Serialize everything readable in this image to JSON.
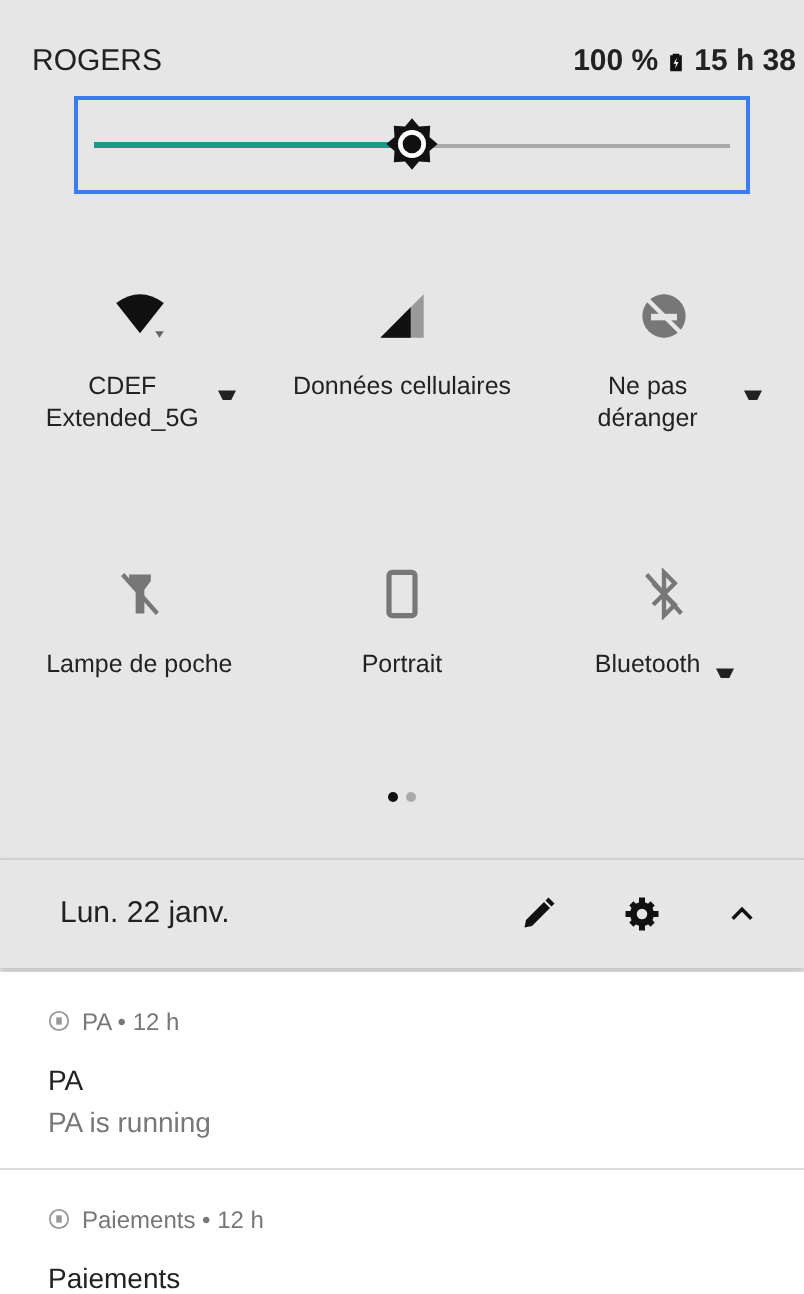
{
  "status_bar": {
    "carrier": "ROGERS",
    "battery": "100 %",
    "time": "15 h 38"
  },
  "brightness": {
    "level": 0.5
  },
  "tiles": [
    {
      "kind": "wifi",
      "label": "CDEF Extended_5G",
      "on": true,
      "menu": true
    },
    {
      "kind": "cellular",
      "label": "Données cellulaires",
      "on": true,
      "menu": false
    },
    {
      "kind": "dnd",
      "label": "Ne pas déranger",
      "on": false,
      "menu": true
    },
    {
      "kind": "flashlight",
      "label": "Lampe de poche",
      "on": false,
      "menu": false
    },
    {
      "kind": "portrait",
      "label": "Portrait",
      "on": false,
      "menu": false
    },
    {
      "kind": "bluetooth",
      "label": "Bluetooth",
      "on": false,
      "menu": true
    }
  ],
  "pages": [
    {
      "selected": true
    },
    {
      "selected": false
    }
  ],
  "date_bar": {
    "date": "Lun. 22 janv."
  },
  "notifications": [
    {
      "app": "PA • 12 h",
      "title": "PA",
      "text": "PA is running"
    },
    {
      "app": "Paiements • 12 h",
      "title": "Paiements"
    }
  ]
}
